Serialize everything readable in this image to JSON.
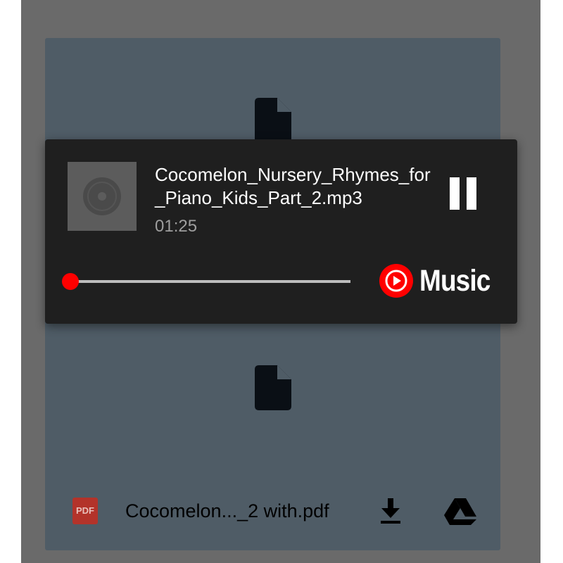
{
  "player": {
    "track_title": "Cocomelon_Nursery_Rhymes_for_Piano_Kids_Part_2.mp3",
    "elapsed": "01:25",
    "progress_fraction": 0.0,
    "brand_word": "Music",
    "accent_color": "#ff0000"
  },
  "attachment": {
    "type_badge": "PDF",
    "filename": "Cocomelon..._2 with.pdf"
  },
  "icons": {
    "file_preview": "file-icon",
    "album_art": "vinyl-disc-icon",
    "pause": "pause-icon",
    "play_brand": "youtube-music-play-icon",
    "download": "download-icon",
    "drive": "google-drive-icon"
  }
}
